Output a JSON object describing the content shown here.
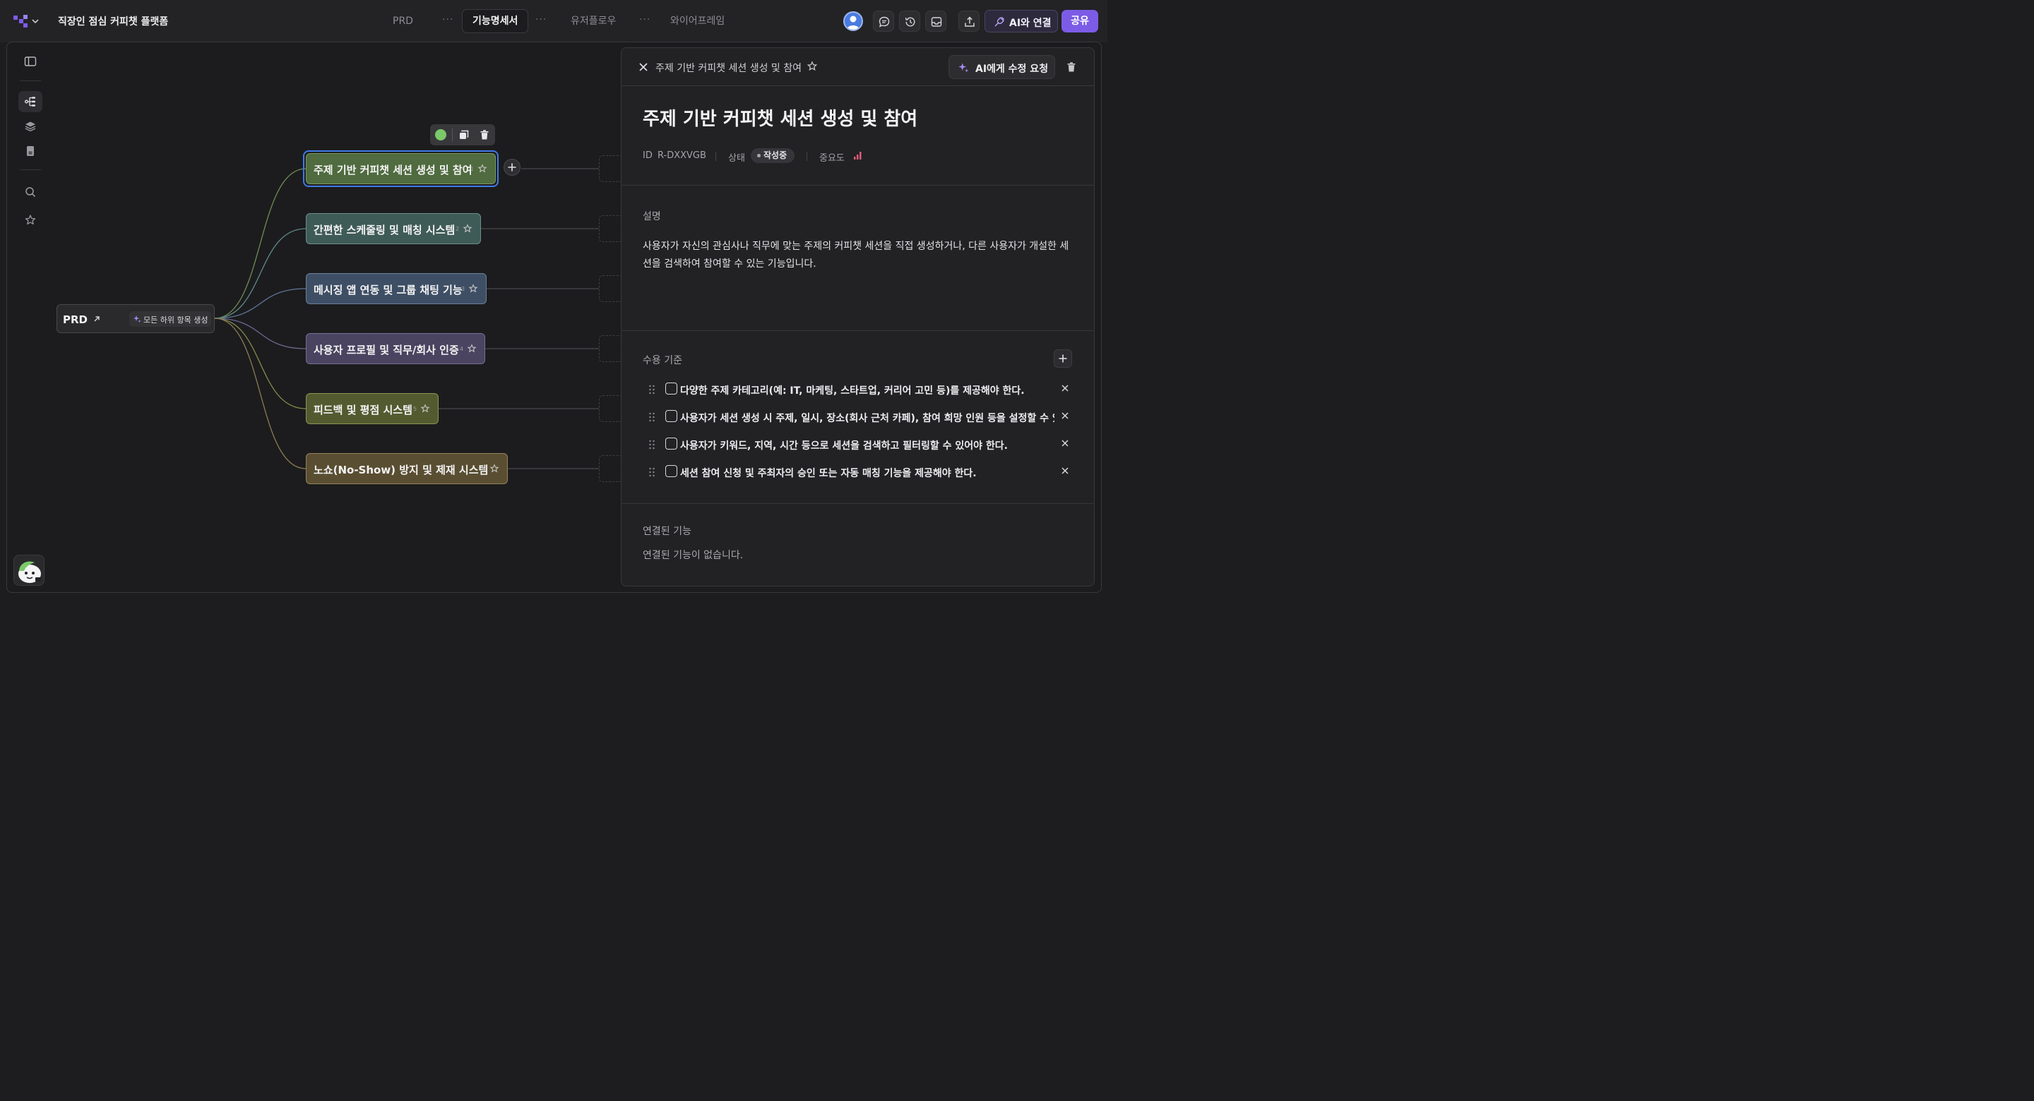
{
  "header": {
    "project_title": "직장인 점심 커피챗 플랫폼",
    "tabs": [
      {
        "label": "PRD"
      },
      {
        "label": "기능명세서",
        "active": true
      },
      {
        "label": "유저플로우"
      },
      {
        "label": "와이어프레임"
      }
    ],
    "tab_more": "···",
    "ai_connect_label": "AI와 연결",
    "share_label": "공유"
  },
  "mindmap": {
    "root": {
      "label": "PRD",
      "generate_label": "모든 하위 항목 생성"
    },
    "nodes": [
      {
        "label": "주제 기반 커피챗 세션 생성 및 참여",
        "num": "1",
        "color": "#4f6b3f",
        "border": "#7a9a5e",
        "line": "#6f8f55"
      },
      {
        "label": "간편한 스케줄링 및 매칭 시스템",
        "num": "2",
        "color": "#3f5b58",
        "border": "#6c8f8a",
        "line": "#5f8c86"
      },
      {
        "label": "메시징 앱 연동 및 그룹 채팅 기능",
        "num": "3",
        "color": "#3e4f65",
        "border": "#6a7f9c",
        "line": "#61789a"
      },
      {
        "label": "사용자 프로필 및 직무/회사 인증",
        "num": "4",
        "color": "#4a4461",
        "border": "#766e96",
        "line": "#6e6790"
      },
      {
        "label": "피드백 및 평점 시스템",
        "num": "5",
        "color": "#545a30",
        "border": "#8c9450",
        "line": "#868f4c"
      },
      {
        "label": "노쇼(No-Show) 방지 및 제재 시스템",
        "num": "6",
        "color": "#5a4e32",
        "border": "#948358",
        "line": "#8d7d54"
      }
    ]
  },
  "panel": {
    "breadcrumb": "주제 기반 커피챗 세션 생성 및 참여",
    "ai_edit_label": "AI에게 수정 요청",
    "title": "주제 기반 커피챗 세션 생성 및 참여",
    "meta": {
      "id_label": "ID",
      "id_value": "R-DXXVGB",
      "status_label": "상태",
      "status_value": "작성중",
      "priority_label": "중요도"
    },
    "description_label": "설명",
    "description": "사용자가 자신의 관심사나 직무에 맞는 주제의 커피챗 세션을 직접 생성하거나, 다른 사용자가 개설한 세션을 검색하여 참여할 수 있는 기능입니다.",
    "acceptance_label": "수용 기준",
    "acceptance": [
      "다양한 주제 카테고리(예: IT, 마케팅, 스타트업, 커리어 고민 등)를 제공해야 한다.",
      "사용자가 세션 생성 시 주제, 일시, 장소(회사 근처 카페), 참여 희망 인원 등을 설정할 수 있어야 한다.",
      "사용자가 키워드, 지역, 시간 등으로 세션을 검색하고 필터링할 수 있어야 한다.",
      "세션 참여 신청 및 주최자의 승인 또는 자동 매칭 기능을 제공해야 한다."
    ],
    "linked_label": "연결된 기능",
    "linked_empty": "연결된 기능이 없습니다."
  },
  "colors": {
    "accent": "#7c5ce6",
    "selection": "#3f7bea",
    "priority": "#e05a7a"
  }
}
